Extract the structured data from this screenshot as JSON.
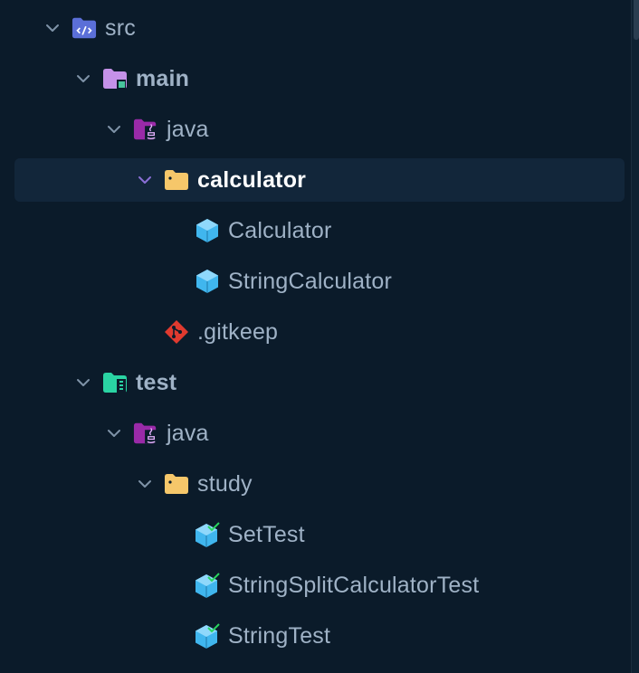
{
  "tree": {
    "items": [
      {
        "label": "src",
        "icon": "source-folder-icon",
        "expanded": true
      },
      {
        "label": "main",
        "icon": "main-folder-icon",
        "expanded": true
      },
      {
        "label": "java",
        "icon": "java-folder-icon",
        "expanded": true
      },
      {
        "label": "calculator",
        "icon": "package-folder-icon",
        "expanded": true,
        "selected": true
      },
      {
        "label": "Calculator",
        "icon": "java-class-icon"
      },
      {
        "label": "StringCalculator",
        "icon": "java-class-icon"
      },
      {
        "label": ".gitkeep",
        "icon": "git-icon"
      },
      {
        "label": "test",
        "icon": "test-folder-icon",
        "expanded": true
      },
      {
        "label": "java",
        "icon": "java-folder-icon",
        "expanded": true
      },
      {
        "label": "study",
        "icon": "package-folder-icon",
        "expanded": true
      },
      {
        "label": "SetTest",
        "icon": "test-class-icon"
      },
      {
        "label": "StringSplitCalculatorTest",
        "icon": "test-class-icon"
      },
      {
        "label": "StringTest",
        "icon": "test-class-icon"
      }
    ]
  },
  "colors": {
    "background": "#0b1b2a",
    "selected_row": "#12263a",
    "label": "#9fb2c6",
    "selected_label": "#ffffff",
    "chevron": "#7f93a8",
    "selected_chevron": "#8b6fd6",
    "folder_yellow": "#f6c76a",
    "java_purple": "#9a2aa8",
    "class_blue": "#40b6ee",
    "git_red": "#e03a2f",
    "test_green": "#2ad4a3"
  }
}
